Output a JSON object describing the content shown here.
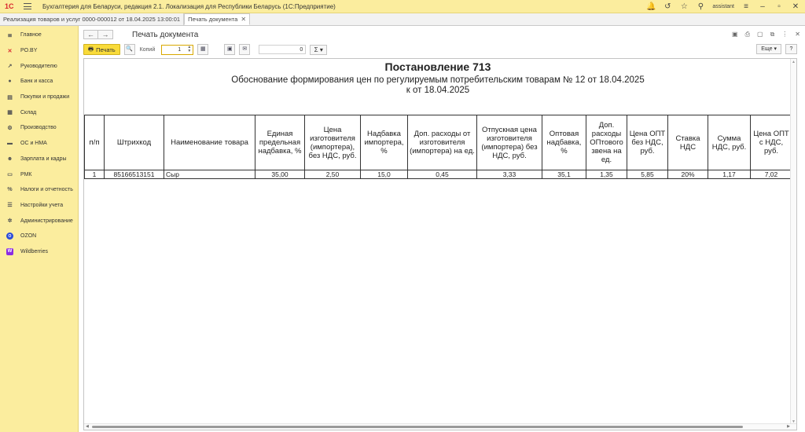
{
  "titlebar": {
    "logo": "1С",
    "title": "Бухгалтерия для Беларуси, редакция 2.1. Локализация для Республики Беларусь   (1С:Предприятие)",
    "user": "assistant"
  },
  "tabs": [
    {
      "label": "Реализация товаров и услуг 0000-000012 от 18.04.2025 13:00:01"
    },
    {
      "label": "Печать документа"
    }
  ],
  "sidebar": {
    "items": [
      {
        "label": "Главное",
        "icon": "menu-icon"
      },
      {
        "label": "PO.BY",
        "icon": "poby-icon"
      },
      {
        "label": "Руководителю",
        "icon": "chart-trend-icon"
      },
      {
        "label": "Банк и касса",
        "icon": "bank-icon"
      },
      {
        "label": "Покупки и продажи",
        "icon": "cart-icon"
      },
      {
        "label": "Склад",
        "icon": "warehouse-icon"
      },
      {
        "label": "Производство",
        "icon": "factory-icon"
      },
      {
        "label": "ОС и НМА",
        "icon": "assets-icon"
      },
      {
        "label": "Зарплата и кадры",
        "icon": "people-icon"
      },
      {
        "label": "РМК",
        "icon": "register-icon"
      },
      {
        "label": "Налоги и отчетность",
        "icon": "tax-icon"
      },
      {
        "label": "Настройки учета",
        "icon": "settings-icon"
      },
      {
        "label": "Администрирование",
        "icon": "gear-icon"
      },
      {
        "label": "OZON",
        "icon": "ozon-icon"
      },
      {
        "label": "Wildberries",
        "icon": "wildberries-icon"
      }
    ]
  },
  "main": {
    "title": "Печать документа",
    "toolbar": {
      "print_label": "Печать",
      "copies_label": "Копий",
      "copies_value": "1",
      "sum_value": "0",
      "sigma_label": "Σ ▾",
      "more_label": "Еще ▾",
      "help_label": "?"
    },
    "document": {
      "heading": "Постановление 713",
      "subheading": "Обоснование формирования цен по регулируемым потребительским товарам № 12 от 18.04.2025",
      "subheading2": "к    от 18.04.2025",
      "columns": [
        "п/п",
        "Штрихкод",
        "Наименование товара",
        "Единая предельная надбавка, %",
        "Цена изготовителя (импортера), без НДС, руб.",
        "Надбавка импортера, %",
        "Доп. расходы от изготовителя (импортера) на ед.",
        "Отпускная цена изготовителя (импортера) без НДС, руб.",
        "Оптовая надбавка, %",
        "Доп. расходы ОПтового звена на ед.",
        "Цена ОПТ без НДС, руб.",
        "Ставка НДС",
        "Сумма НДС, руб.",
        "Цена ОПТ с НДС, руб."
      ],
      "rows": [
        [
          "1",
          "85166513151",
          "Сыр",
          "35,00",
          "2,50",
          "15,0",
          "0,45",
          "3,33",
          "35,1",
          "1,35",
          "5,85",
          "20%",
          "1,17",
          "7,02"
        ]
      ]
    }
  }
}
